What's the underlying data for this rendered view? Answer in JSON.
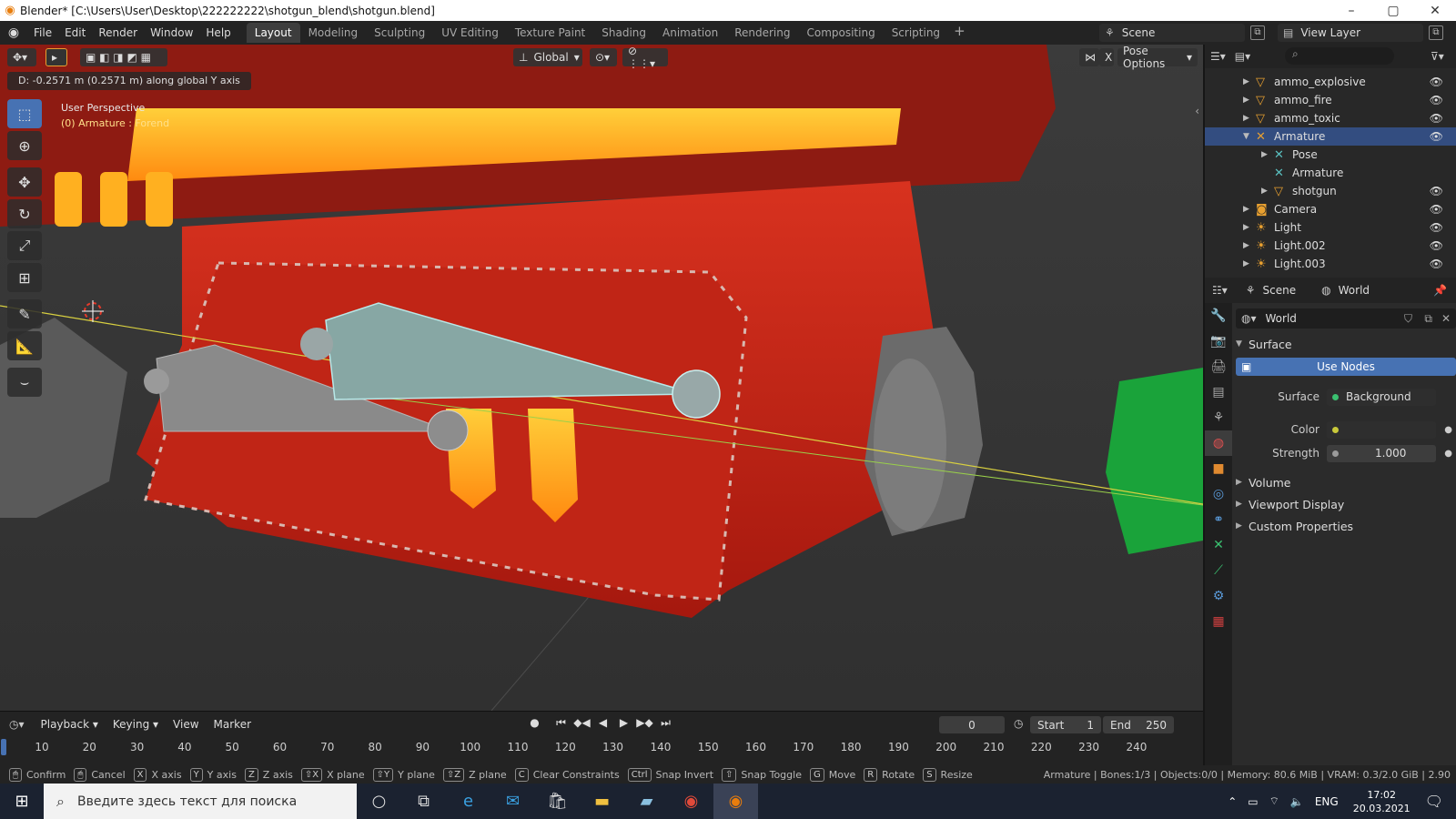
{
  "window": {
    "title": "Blender* [C:\\Users\\User\\Desktop\\222222222\\shotgun_blend\\shotgun.blend]",
    "controls": [
      "–",
      "▢",
      "✕"
    ]
  },
  "menu": [
    "File",
    "Edit",
    "Render",
    "Window",
    "Help"
  ],
  "workspaces": [
    "Layout",
    "Modeling",
    "Sculpting",
    "UV Editing",
    "Texture Paint",
    "Shading",
    "Animation",
    "Rendering",
    "Compositing",
    "Scripting"
  ],
  "active_workspace": "Layout",
  "scene": "Scene",
  "view_layer": "View Layer",
  "viewport": {
    "orientation": "Global",
    "pose_options": "Pose Options",
    "operation_status": "D: -0.2571 m (0.2571 m) along global Y axis",
    "perspective": "User Perspective",
    "active_object": "(0) Armature : Forend",
    "x_label": "X"
  },
  "outliner": {
    "search_icon": "search-icon",
    "rows": [
      {
        "label": "ammo_explosive",
        "icon": "mesh-icon",
        "depth": 1
      },
      {
        "label": "ammo_fire",
        "icon": "mesh-icon",
        "depth": 1
      },
      {
        "label": "ammo_toxic",
        "icon": "mesh-icon",
        "depth": 1
      },
      {
        "label": "Armature",
        "icon": "armature-icon",
        "depth": 1,
        "selected": true
      },
      {
        "label": "Pose",
        "icon": "pose-icon",
        "depth": 2
      },
      {
        "label": "Armature",
        "icon": "armature-data-icon",
        "depth": 2
      },
      {
        "label": "shotgun",
        "icon": "mesh-icon",
        "depth": 2
      },
      {
        "label": "Camera",
        "icon": "camera-icon",
        "depth": 1
      },
      {
        "label": "Light",
        "icon": "light-icon",
        "depth": 1
      },
      {
        "label": "Light.002",
        "icon": "light-icon",
        "depth": 1
      },
      {
        "label": "Light.003",
        "icon": "light-icon",
        "depth": 1
      }
    ]
  },
  "properties": {
    "tabs_header": {
      "scene": "Scene",
      "world": "World"
    },
    "world_name": "World",
    "surface_section": "Surface",
    "use_nodes": "Use Nodes",
    "surface_label": "Surface",
    "surface_value": "Background",
    "color_label": "Color",
    "strength_label": "Strength",
    "strength_value": "1.000",
    "sections": [
      "Volume",
      "Viewport Display",
      "Custom Properties"
    ]
  },
  "timeline": {
    "menus": [
      "Playback",
      "Keying",
      "View",
      "Marker"
    ],
    "current_frame": "0",
    "start_label": "Start",
    "start_value": "1",
    "end_label": "End",
    "end_value": "250",
    "ticks": [
      "10",
      "20",
      "30",
      "40",
      "50",
      "60",
      "70",
      "80",
      "90",
      "100",
      "110",
      "120",
      "130",
      "140",
      "150",
      "160",
      "170",
      "180",
      "190",
      "200",
      "210",
      "220",
      "230",
      "240"
    ]
  },
  "statusbar": {
    "hints": [
      {
        "key": "",
        "label": "Confirm"
      },
      {
        "key": "",
        "label": "Cancel"
      },
      {
        "key": "X",
        "label": "X axis"
      },
      {
        "key": "Y",
        "label": "Y axis"
      },
      {
        "key": "Z",
        "label": "Z axis"
      },
      {
        "key": "⇧X",
        "label": "X plane"
      },
      {
        "key": "⇧Y",
        "label": "Y plane"
      },
      {
        "key": "⇧Z",
        "label": "Z plane"
      },
      {
        "key": "C",
        "label": "Clear Constraints"
      },
      {
        "key": "Ctrl",
        "label": "Snap Invert"
      },
      {
        "key": "⇧",
        "label": "Snap Toggle"
      },
      {
        "key": "G",
        "label": "Move"
      },
      {
        "key": "R",
        "label": "Rotate"
      },
      {
        "key": "S",
        "label": "Resize"
      }
    ],
    "info": "Armature | Bones:1/3 | Objects:0/0 | Memory: 80.6 MiB | VRAM: 0.3/2.0 GiB | 2.90"
  },
  "taskbar": {
    "search_placeholder": "Введите здесь текст для поиска",
    "language": "ENG",
    "time": "17:02",
    "date": "20.03.2021"
  }
}
